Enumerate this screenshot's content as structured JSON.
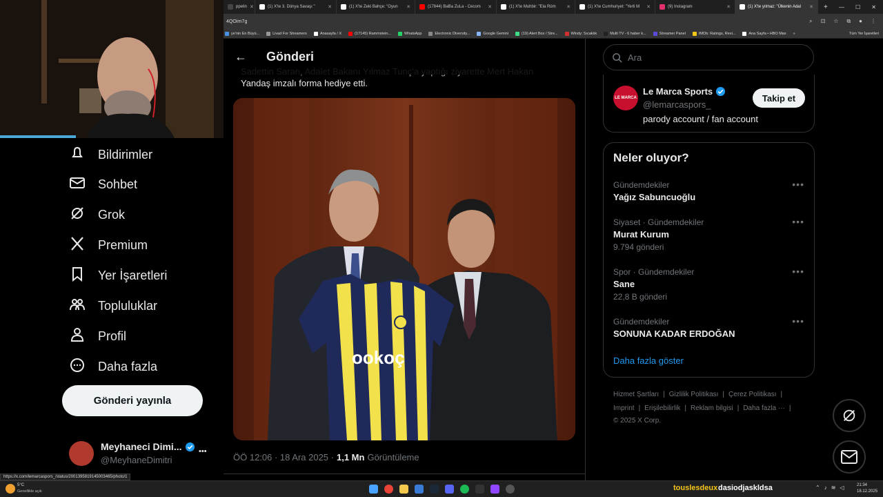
{
  "browser": {
    "tabs": [
      {
        "label": "ppelin",
        "favicon_color": "#444444"
      },
      {
        "label": "(1) X'te 3. Dünya Savaşı \"",
        "favicon_color": "#ffffff"
      },
      {
        "label": "(1) X'te Zeki Bahçe: \"Oyun",
        "favicon_color": "#ffffff"
      },
      {
        "label": "(17844) BaBa ZuLa - Cecom",
        "favicon_color": "#ff0000"
      },
      {
        "label": "(1) X'te Muhbir: \"Ela Rüm",
        "favicon_color": "#ffffff"
      },
      {
        "label": "(1) X'te Cumhuriyet: \"Yerli M",
        "favicon_color": "#ffffff"
      },
      {
        "label": "(9) Instagram",
        "favicon_color": "#e1306c"
      },
      {
        "label": "(1) X'te yılmaz: \"Ülkenin Adal",
        "favicon_color": "#ffffff",
        "active": true
      }
    ],
    "new_tab": "+",
    "address_text": "4QOirn7g",
    "bookmarks": [
      {
        "label": "ye'nin En Büyü...",
        "color": "#4a90e2"
      },
      {
        "label": "Livad For Streamers",
        "color": "#999999"
      },
      {
        "label": "Anasayfa / X",
        "color": "#ffffff"
      },
      {
        "label": "(17145) Rammstein...",
        "color": "#ff0000"
      },
      {
        "label": "WhatsApp",
        "color": "#25d366"
      },
      {
        "label": "Electronic Diversity...",
        "color": "#888888"
      },
      {
        "label": "Google Gemini",
        "color": "#8ab4f8"
      },
      {
        "label": "(19) Alert Box / Stre...",
        "color": "#3ddc84"
      },
      {
        "label": "Windy: Sıcaklık",
        "color": "#d32f2f"
      },
      {
        "label": "Multi TV - 6 haber k...",
        "color": "#222222"
      },
      {
        "label": "Streamer Panel",
        "color": "#5b4bdb"
      },
      {
        "label": "IMDb: Ratings, Revi...",
        "color": "#f5c518"
      },
      {
        "label": "Ana Sayfa • HBO Max",
        "color": "#ffffff"
      }
    ],
    "bookmarks_more": "»",
    "all_bookmarks": "Tüm Yer İşaretleri"
  },
  "left_nav": {
    "items": [
      {
        "label": "Bildirimler",
        "icon": "bell-icon"
      },
      {
        "label": "Sohbet",
        "icon": "mail-icon"
      },
      {
        "label": "Grok",
        "icon": "grok-icon"
      },
      {
        "label": "Premium",
        "icon": "x-logo-icon"
      },
      {
        "label": "Yer İşaretleri",
        "icon": "bookmark-icon"
      },
      {
        "label": "Topluluklar",
        "icon": "communities-icon"
      },
      {
        "label": "Profil",
        "icon": "person-icon"
      },
      {
        "label": "Daha fazla",
        "icon": "more-circle-icon"
      }
    ],
    "post_button": "Gönderi yayınla",
    "account": {
      "name": "Meyhaneci Dimi...",
      "handle": "@MeyhaneDimitri",
      "more": "•••"
    }
  },
  "post": {
    "header_title": "Gönderi",
    "text_line1": "Sadettin Saran, Adalet Bakanı Yılmaz Tunç'a yaptığı ziyarette Mert Hakan",
    "text_line2": "Yandaş imzalı forma hediye etti.",
    "jersey_sponsor": "ookoç",
    "timestamp": "ÖÖ 12:06 · 18 Ara 2025 ·",
    "views_count": "1,1 Mn",
    "views_label": "Görüntüleme"
  },
  "search": {
    "placeholder": "Ara"
  },
  "suggested_account": {
    "avatar_text": "LE MARCA",
    "name": "Le Marca Sports",
    "handle": "@lemarcaspors_",
    "bio": "parody account / fan account",
    "follow_label": "Takip et"
  },
  "trends": {
    "title": "Neler oluyor?",
    "items": [
      {
        "meta": "Gündemdekiler",
        "name": "Yağız Sabuncuoğlu",
        "count": ""
      },
      {
        "meta": "Siyaset · Gündemdekiler",
        "name": "Murat Kurum",
        "count": "9.794 gönderi"
      },
      {
        "meta": "Spor · Gündemdekiler",
        "name": "Sane",
        "count": "22,8 B gönderi"
      },
      {
        "meta": "Gündemdekiler",
        "name": "SONUNA KADAR ERDOĞAN",
        "count": ""
      }
    ],
    "more_dots": "•••",
    "show_more": "Daha fazla göster"
  },
  "footer": {
    "links_row1": [
      "Hizmet Şartları",
      "Gizlilik Politikası",
      "Çerez Politikası"
    ],
    "links_row2": [
      "Imprint",
      "Erişilebilirlik",
      "Reklam bilgisi",
      "Daha fazla ···"
    ],
    "copyright": "© 2025 X Corp."
  },
  "status_url": "https://x.com/lemarcaspors_/status/2001395819145003465/photo/1",
  "taskbar": {
    "weather_temp": "5°C",
    "weather_desc": "Genellikle açık",
    "stream_name1": "touslesdeux",
    "stream_name2": "dasiodjaskldsa",
    "clock_time": "21:34",
    "clock_date": "18.12.2025"
  },
  "colors": {
    "accent": "#1d9bf0",
    "verified": "#1d9bf0",
    "muted": "#71767b",
    "stream_name": "#f5c518"
  }
}
